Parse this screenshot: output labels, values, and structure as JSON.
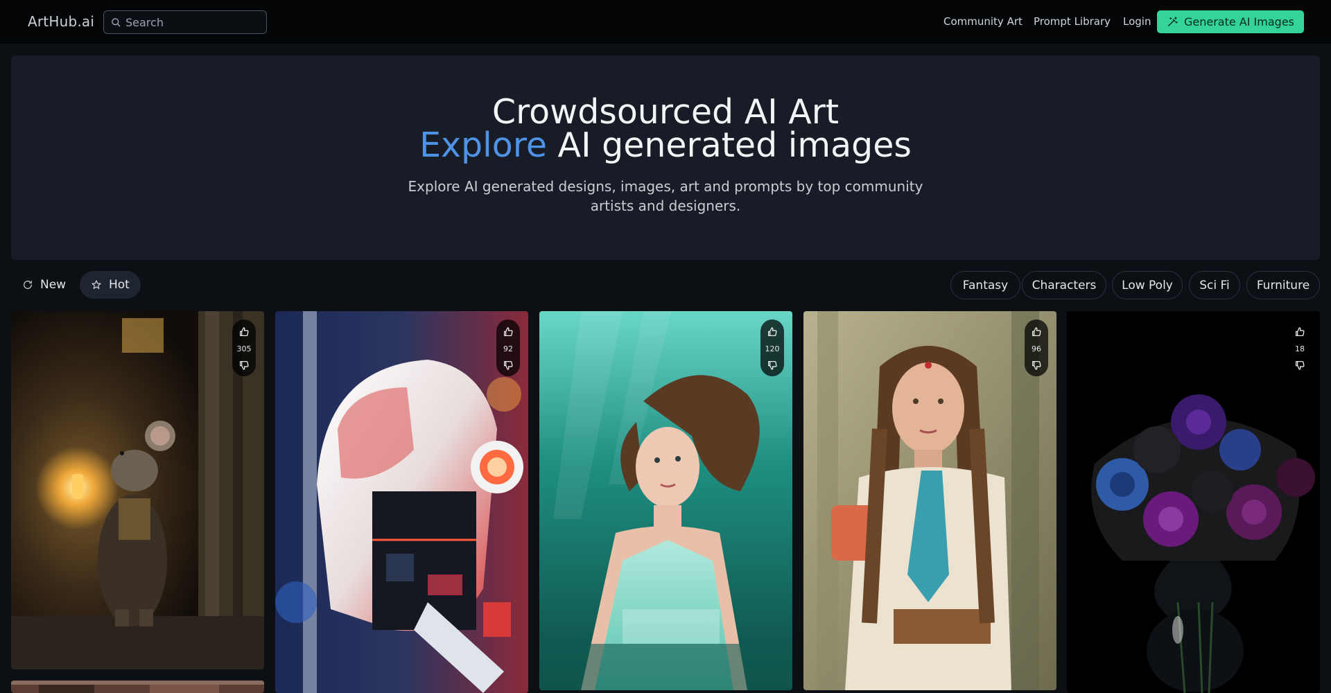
{
  "nav": {
    "logo": "ArtHub.ai",
    "search_placeholder": "Search",
    "links": [
      "Community Art",
      "Prompt Library",
      "Login"
    ],
    "cta": "Generate AI Images",
    "cta_color": "#34d399"
  },
  "hero": {
    "title_line1": "Crowdsourced AI Art",
    "title_accent": "Explore",
    "title_rest": " AI generated images",
    "subtitle": "Explore AI generated designs, images, art and prompts by top community artists and designers.",
    "accent_color": "#4f93e8"
  },
  "sort": {
    "new_label": "New",
    "hot_label": "Hot",
    "active": "Hot"
  },
  "categories": [
    "Fantasy",
    "Characters",
    "Low Poly",
    "Sci Fi",
    "Furniture"
  ],
  "cards": [
    {
      "votes": "305",
      "subject": "mouse-with-lantern"
    },
    {
      "votes": "92",
      "subject": "robot-helmet"
    },
    {
      "votes": "120",
      "subject": "underwater-woman"
    },
    {
      "votes": "96",
      "subject": "braided-woman"
    },
    {
      "votes": "18",
      "subject": "black-roses"
    }
  ],
  "icons": {
    "search": "search-icon",
    "generate": "magic-wand-icon",
    "new": "refresh-icon",
    "hot": "star-icon",
    "upvote": "thumbs-up-icon",
    "downvote": "thumbs-down-icon"
  }
}
